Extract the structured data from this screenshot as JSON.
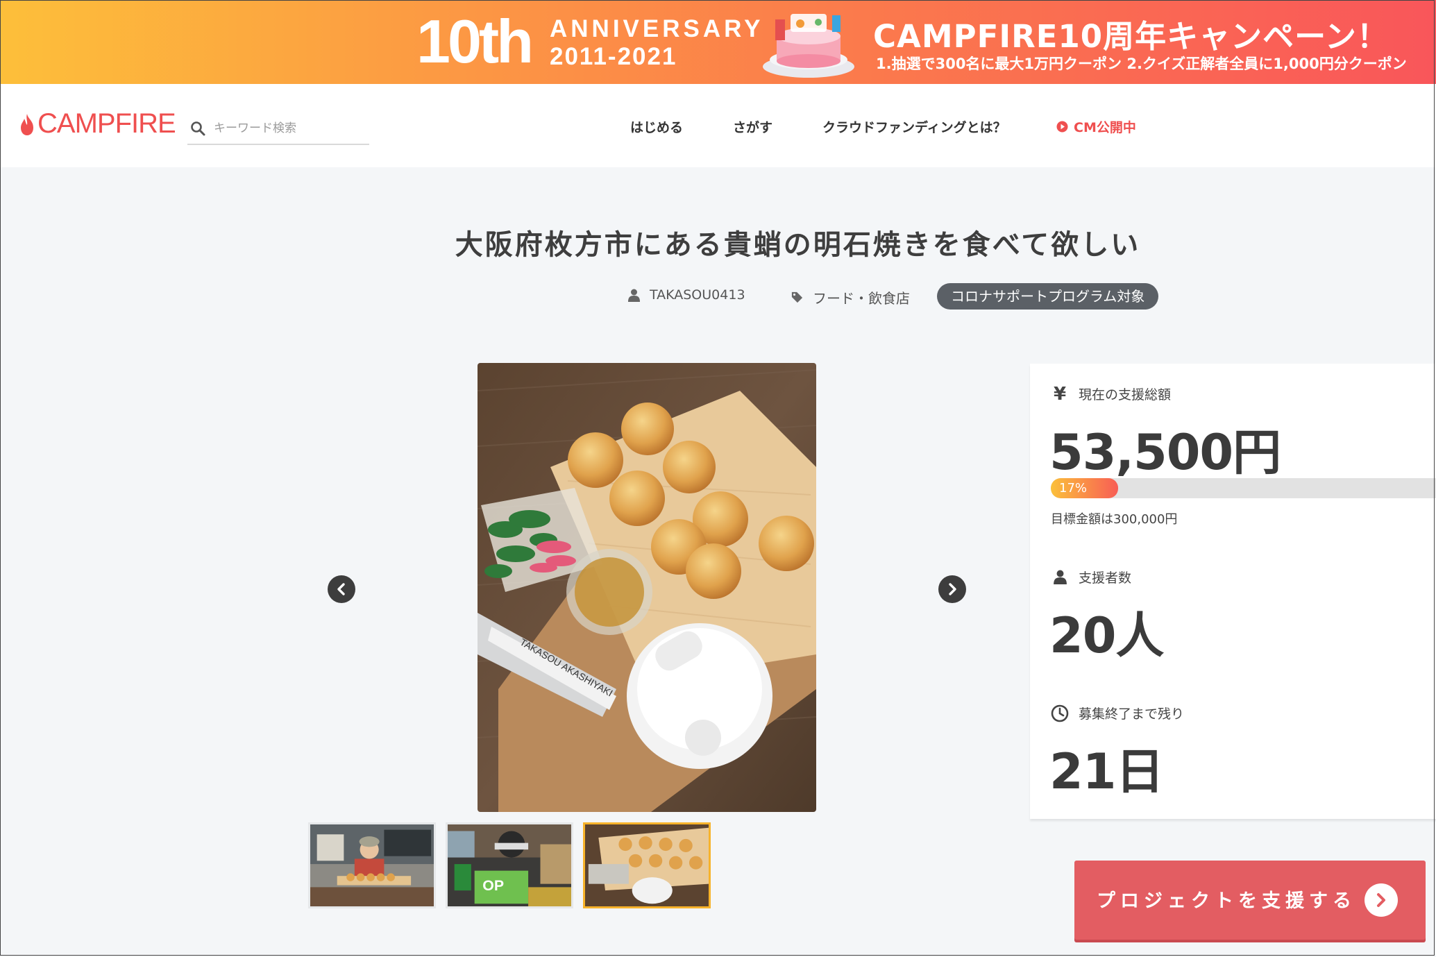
{
  "banner": {
    "tenth": "10th",
    "anniversary": "ANNIVERSARY",
    "years": "2011-2021",
    "campaign_title": "CAMPFIRE10周年キャンペーン！",
    "campaign_sub": "1.抽選で300名に最大1万円クーポン 2.クイズ正解者全員に1,000円分クーポン"
  },
  "header": {
    "logo": "CAMPFIRE",
    "search_placeholder": "キーワード検索",
    "nav": [
      "はじめる",
      "さがす",
      "クラウドファンディングとは？",
      "CM公開中"
    ]
  },
  "project": {
    "title": "大阪府枚方市にある貴蛸の明石焼きを食べて欲しい",
    "user": "TAKASOU0413",
    "category": "フード・飲食店",
    "badge": "コロナサポートプログラム対象",
    "thumbnails_count": 3,
    "active_thumbnail": 3
  },
  "stats": {
    "currency_icon": "¥",
    "raised_label": "現在の支援総額",
    "raised_value": "53,500円",
    "progress_percent": 17,
    "progress_text": "17%",
    "goal_text": "目標金額は300,000円",
    "backers_label": "支援者数",
    "backers_value": "20人",
    "remaining_label": "募集終了まで残り",
    "remaining_value": "21日"
  },
  "cta": {
    "label": "プロジェクトを支援する"
  },
  "colors": {
    "brand": "#ef4f4f",
    "cta": "#e35d62",
    "badge": "#5b6066",
    "thumb_active": "#f7b32b"
  }
}
